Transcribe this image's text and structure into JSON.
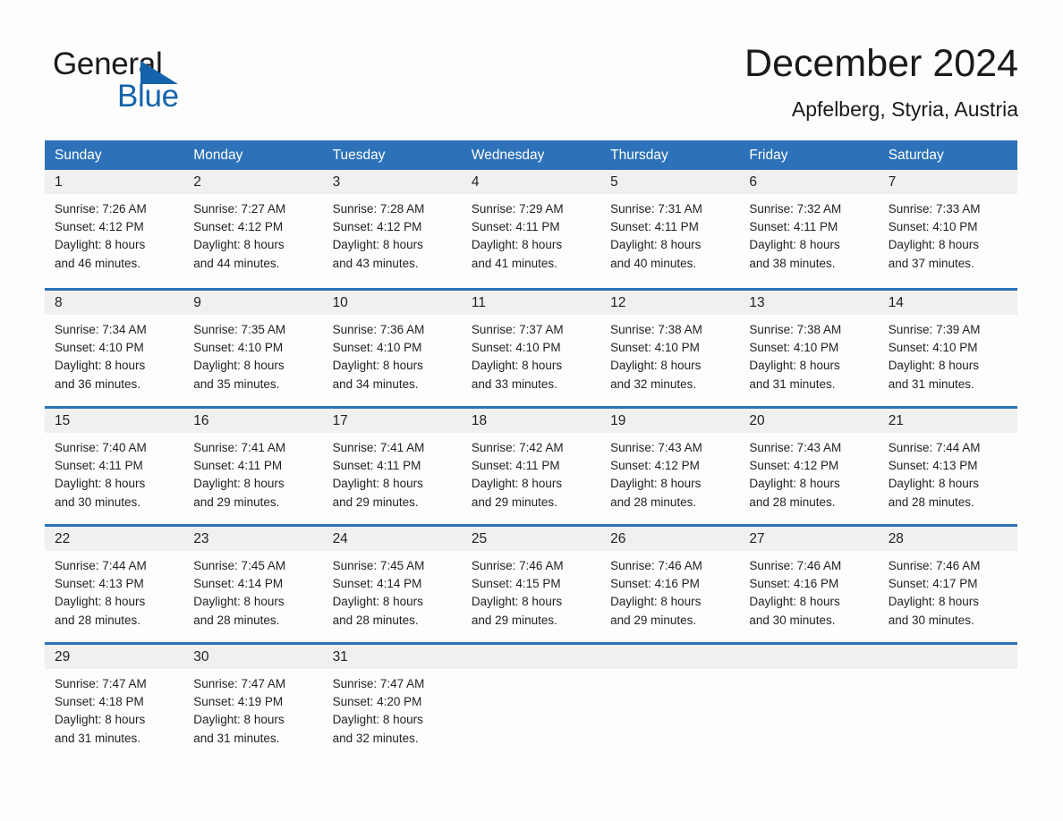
{
  "logo": {
    "line1": "General",
    "line2": "Blue",
    "triangle_color": "#1464ab",
    "text_color": "#1a1a1a"
  },
  "header": {
    "month_title": "December 2024",
    "location": "Apfelberg, Styria, Austria"
  },
  "theme": {
    "header_blue": "#2d72b8",
    "row_divider_blue": "#2d72b8",
    "day_band_gray": "#f0f0f0",
    "page_background": "#fdfdfd",
    "text": "#231f20"
  },
  "calendar": {
    "weekdays": [
      "Sunday",
      "Monday",
      "Tuesday",
      "Wednesday",
      "Thursday",
      "Friday",
      "Saturday"
    ],
    "weeks": [
      [
        {
          "day": "1",
          "sunrise": "Sunrise: 7:26 AM",
          "sunset": "Sunset: 4:12 PM",
          "daylight1": "Daylight: 8 hours",
          "daylight2": "and 46 minutes."
        },
        {
          "day": "2",
          "sunrise": "Sunrise: 7:27 AM",
          "sunset": "Sunset: 4:12 PM",
          "daylight1": "Daylight: 8 hours",
          "daylight2": "and 44 minutes."
        },
        {
          "day": "3",
          "sunrise": "Sunrise: 7:28 AM",
          "sunset": "Sunset: 4:12 PM",
          "daylight1": "Daylight: 8 hours",
          "daylight2": "and 43 minutes."
        },
        {
          "day": "4",
          "sunrise": "Sunrise: 7:29 AM",
          "sunset": "Sunset: 4:11 PM",
          "daylight1": "Daylight: 8 hours",
          "daylight2": "and 41 minutes."
        },
        {
          "day": "5",
          "sunrise": "Sunrise: 7:31 AM",
          "sunset": "Sunset: 4:11 PM",
          "daylight1": "Daylight: 8 hours",
          "daylight2": "and 40 minutes."
        },
        {
          "day": "6",
          "sunrise": "Sunrise: 7:32 AM",
          "sunset": "Sunset: 4:11 PM",
          "daylight1": "Daylight: 8 hours",
          "daylight2": "and 38 minutes."
        },
        {
          "day": "7",
          "sunrise": "Sunrise: 7:33 AM",
          "sunset": "Sunset: 4:10 PM",
          "daylight1": "Daylight: 8 hours",
          "daylight2": "and 37 minutes."
        }
      ],
      [
        {
          "day": "8",
          "sunrise": "Sunrise: 7:34 AM",
          "sunset": "Sunset: 4:10 PM",
          "daylight1": "Daylight: 8 hours",
          "daylight2": "and 36 minutes."
        },
        {
          "day": "9",
          "sunrise": "Sunrise: 7:35 AM",
          "sunset": "Sunset: 4:10 PM",
          "daylight1": "Daylight: 8 hours",
          "daylight2": "and 35 minutes."
        },
        {
          "day": "10",
          "sunrise": "Sunrise: 7:36 AM",
          "sunset": "Sunset: 4:10 PM",
          "daylight1": "Daylight: 8 hours",
          "daylight2": "and 34 minutes."
        },
        {
          "day": "11",
          "sunrise": "Sunrise: 7:37 AM",
          "sunset": "Sunset: 4:10 PM",
          "daylight1": "Daylight: 8 hours",
          "daylight2": "and 33 minutes."
        },
        {
          "day": "12",
          "sunrise": "Sunrise: 7:38 AM",
          "sunset": "Sunset: 4:10 PM",
          "daylight1": "Daylight: 8 hours",
          "daylight2": "and 32 minutes."
        },
        {
          "day": "13",
          "sunrise": "Sunrise: 7:38 AM",
          "sunset": "Sunset: 4:10 PM",
          "daylight1": "Daylight: 8 hours",
          "daylight2": "and 31 minutes."
        },
        {
          "day": "14",
          "sunrise": "Sunrise: 7:39 AM",
          "sunset": "Sunset: 4:10 PM",
          "daylight1": "Daylight: 8 hours",
          "daylight2": "and 31 minutes."
        }
      ],
      [
        {
          "day": "15",
          "sunrise": "Sunrise: 7:40 AM",
          "sunset": "Sunset: 4:11 PM",
          "daylight1": "Daylight: 8 hours",
          "daylight2": "and 30 minutes."
        },
        {
          "day": "16",
          "sunrise": "Sunrise: 7:41 AM",
          "sunset": "Sunset: 4:11 PM",
          "daylight1": "Daylight: 8 hours",
          "daylight2": "and 29 minutes."
        },
        {
          "day": "17",
          "sunrise": "Sunrise: 7:41 AM",
          "sunset": "Sunset: 4:11 PM",
          "daylight1": "Daylight: 8 hours",
          "daylight2": "and 29 minutes."
        },
        {
          "day": "18",
          "sunrise": "Sunrise: 7:42 AM",
          "sunset": "Sunset: 4:11 PM",
          "daylight1": "Daylight: 8 hours",
          "daylight2": "and 29 minutes."
        },
        {
          "day": "19",
          "sunrise": "Sunrise: 7:43 AM",
          "sunset": "Sunset: 4:12 PM",
          "daylight1": "Daylight: 8 hours",
          "daylight2": "and 28 minutes."
        },
        {
          "day": "20",
          "sunrise": "Sunrise: 7:43 AM",
          "sunset": "Sunset: 4:12 PM",
          "daylight1": "Daylight: 8 hours",
          "daylight2": "and 28 minutes."
        },
        {
          "day": "21",
          "sunrise": "Sunrise: 7:44 AM",
          "sunset": "Sunset: 4:13 PM",
          "daylight1": "Daylight: 8 hours",
          "daylight2": "and 28 minutes."
        }
      ],
      [
        {
          "day": "22",
          "sunrise": "Sunrise: 7:44 AM",
          "sunset": "Sunset: 4:13 PM",
          "daylight1": "Daylight: 8 hours",
          "daylight2": "and 28 minutes."
        },
        {
          "day": "23",
          "sunrise": "Sunrise: 7:45 AM",
          "sunset": "Sunset: 4:14 PM",
          "daylight1": "Daylight: 8 hours",
          "daylight2": "and 28 minutes."
        },
        {
          "day": "24",
          "sunrise": "Sunrise: 7:45 AM",
          "sunset": "Sunset: 4:14 PM",
          "daylight1": "Daylight: 8 hours",
          "daylight2": "and 28 minutes."
        },
        {
          "day": "25",
          "sunrise": "Sunrise: 7:46 AM",
          "sunset": "Sunset: 4:15 PM",
          "daylight1": "Daylight: 8 hours",
          "daylight2": "and 29 minutes."
        },
        {
          "day": "26",
          "sunrise": "Sunrise: 7:46 AM",
          "sunset": "Sunset: 4:16 PM",
          "daylight1": "Daylight: 8 hours",
          "daylight2": "and 29 minutes."
        },
        {
          "day": "27",
          "sunrise": "Sunrise: 7:46 AM",
          "sunset": "Sunset: 4:16 PM",
          "daylight1": "Daylight: 8 hours",
          "daylight2": "and 30 minutes."
        },
        {
          "day": "28",
          "sunrise": "Sunrise: 7:46 AM",
          "sunset": "Sunset: 4:17 PM",
          "daylight1": "Daylight: 8 hours",
          "daylight2": "and 30 minutes."
        }
      ],
      [
        {
          "day": "29",
          "sunrise": "Sunrise: 7:47 AM",
          "sunset": "Sunset: 4:18 PM",
          "daylight1": "Daylight: 8 hours",
          "daylight2": "and 31 minutes."
        },
        {
          "day": "30",
          "sunrise": "Sunrise: 7:47 AM",
          "sunset": "Sunset: 4:19 PM",
          "daylight1": "Daylight: 8 hours",
          "daylight2": "and 31 minutes."
        },
        {
          "day": "31",
          "sunrise": "Sunrise: 7:47 AM",
          "sunset": "Sunset: 4:20 PM",
          "daylight1": "Daylight: 8 hours",
          "daylight2": "and 32 minutes."
        },
        {
          "day": "",
          "sunrise": "",
          "sunset": "",
          "daylight1": "",
          "daylight2": ""
        },
        {
          "day": "",
          "sunrise": "",
          "sunset": "",
          "daylight1": "",
          "daylight2": ""
        },
        {
          "day": "",
          "sunrise": "",
          "sunset": "",
          "daylight1": "",
          "daylight2": ""
        },
        {
          "day": "",
          "sunrise": "",
          "sunset": "",
          "daylight1": "",
          "daylight2": ""
        }
      ]
    ]
  }
}
